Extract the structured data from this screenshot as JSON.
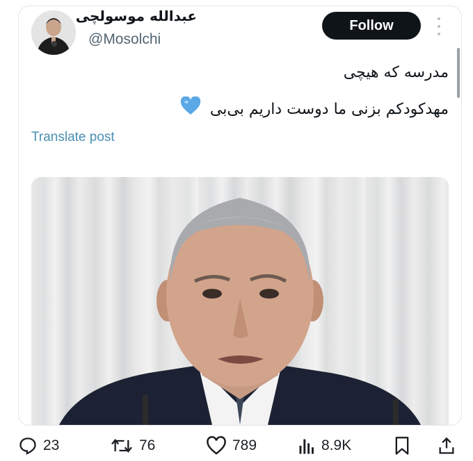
{
  "tweet": {
    "author_name": "عبدالله موسولچی",
    "handle": "@Mosolchi",
    "follow_label": "Follow",
    "text_line1": "مدرسه که هیچی",
    "text_line2": "مهدکودکم بزنی ما دوست داریم بی‌بی",
    "emoji": "blue-heart-icon",
    "translate_label": "Translate post"
  },
  "actions": {
    "replies": "23",
    "reposts": "76",
    "likes": "789",
    "views": "8.9K"
  },
  "colors": {
    "follow_bg": "#0f1419",
    "link": "#4a8fb4",
    "heart": "#5aa9e6",
    "secondary_text": "#536471"
  }
}
